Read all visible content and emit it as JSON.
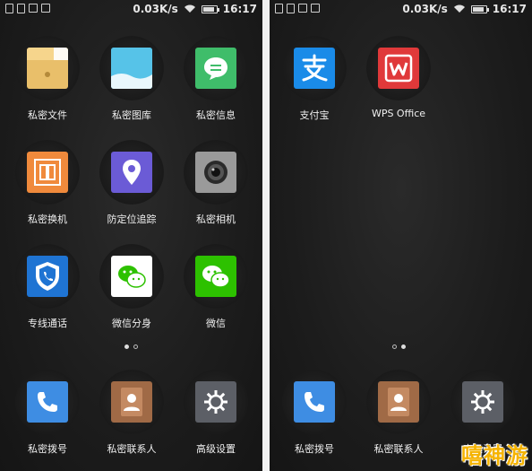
{
  "left_screen": {
    "status": {
      "speed": "0.03K/s",
      "time": "16:17"
    },
    "apps": [
      {
        "label": "私密文件",
        "icon": "folder-icon",
        "color": "#e9bf6a"
      },
      {
        "label": "私密图库",
        "icon": "gallery-icon",
        "color": "#3fb0d8"
      },
      {
        "label": "私密信息",
        "icon": "message-icon",
        "color": "#3fbd6a"
      },
      {
        "label": "私密换机",
        "icon": "transfer-icon",
        "color": "#f08a3c"
      },
      {
        "label": "防定位追踪",
        "icon": "location-pin-icon",
        "color": "#6b5bd6"
      },
      {
        "label": "私密相机",
        "icon": "camera-icon",
        "color": "#8a8a8a"
      },
      {
        "label": "专线通话",
        "icon": "shield-phone-icon",
        "color": "#1f74d3"
      },
      {
        "label": "微信分身",
        "icon": "wechat-icon",
        "color": "#ffffff"
      },
      {
        "label": "微信",
        "icon": "wechat-icon",
        "color": "#2dc100"
      }
    ],
    "dock": [
      {
        "label": "私密拨号",
        "icon": "phone-icon",
        "color": "#3e8de3"
      },
      {
        "label": "私密联系人",
        "icon": "contact-icon",
        "color": "#a06a46"
      },
      {
        "label": "高级设置",
        "icon": "gear-icon",
        "color": "#5c5f66"
      }
    ],
    "page_indicator": {
      "pages": 2,
      "active": 0
    }
  },
  "right_screen": {
    "status": {
      "speed": "0.03K/s",
      "time": "16:17"
    },
    "apps": [
      {
        "label": "支付宝",
        "icon": "alipay-icon",
        "color": "#1a8be8"
      },
      {
        "label": "WPS Office",
        "icon": "wps-icon",
        "color": "#e0393a"
      }
    ],
    "dock": [
      {
        "label": "私密拨号",
        "icon": "phone-icon",
        "color": "#3e8de3"
      },
      {
        "label": "私密联系人",
        "icon": "contact-icon",
        "color": "#a06a46"
      },
      {
        "label": "高级设置",
        "icon": "gear-icon",
        "color": "#5c5f66"
      }
    ],
    "page_indicator": {
      "pages": 2,
      "active": 1
    }
  },
  "watermark": "嘻神游"
}
